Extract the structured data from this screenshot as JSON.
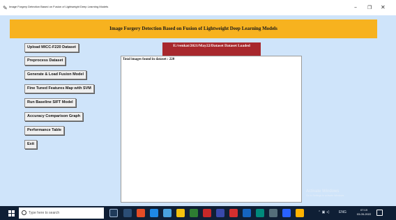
{
  "window": {
    "title": "Image Forgery Detection Based on Fusion of Lightweight Deep Learning Models",
    "minimize": "–",
    "maximize": "❐",
    "close": "✕"
  },
  "banner": {
    "title": "Image Forgery Detection Based on Fusion of Lightweight Deep Learning Models"
  },
  "status_label": "E:/venkat/2021/May22/Dataset Dataset Loaded",
  "buttons": [
    "Upload MICC-F220 Dataset",
    "Preprocess Dataset",
    "Generate & Load Fusion Model",
    "Fine Tuned Features Map with SVM",
    "Run Baseline SIFT Model",
    "Accuracy Comparison Graph",
    "Performance Table",
    "Exit"
  ],
  "output_text": "Total images found in dataset : 220",
  "watermark": {
    "title": "Activate Windows",
    "subtitle": "Go to Settings to activate Windows."
  },
  "taskbar": {
    "search_placeholder": "Type here to search",
    "tray_text": "ENG",
    "time": "07:19",
    "date": "03-05-2022"
  },
  "colors": {
    "client_bg": "#cfe4fa",
    "banner_bg": "#f7b21f",
    "status_bg": "#a8282d",
    "taskbar_bg": "#0f1f35"
  }
}
